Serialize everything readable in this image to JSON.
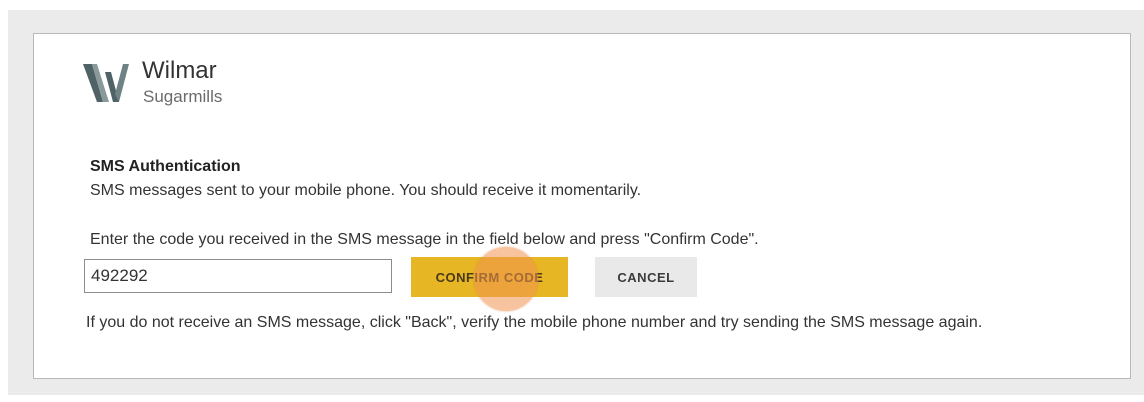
{
  "brand": {
    "name": "Wilmar",
    "subtitle": "Sugarmills",
    "logo_icon": "wilmar-w-logo",
    "logo_color": "#5b6b6e"
  },
  "auth": {
    "heading": "SMS Authentication",
    "sent_message": "SMS messages sent to your mobile phone. You should receive it momentarily.",
    "instruction": "Enter the code you received in the SMS message in the field below and press \"Confirm Code\".",
    "code_value": "492292",
    "help_text": "If you do not receive an SMS message, click \"Back\", verify the mobile phone number and try sending the SMS message again."
  },
  "buttons": {
    "confirm_label": "CONFIRM CODE",
    "cancel_label": "CANCEL"
  },
  "colors": {
    "confirm_button": "#e6b624",
    "cancel_button": "#e9e9e9",
    "click_marker": "#f09450"
  }
}
